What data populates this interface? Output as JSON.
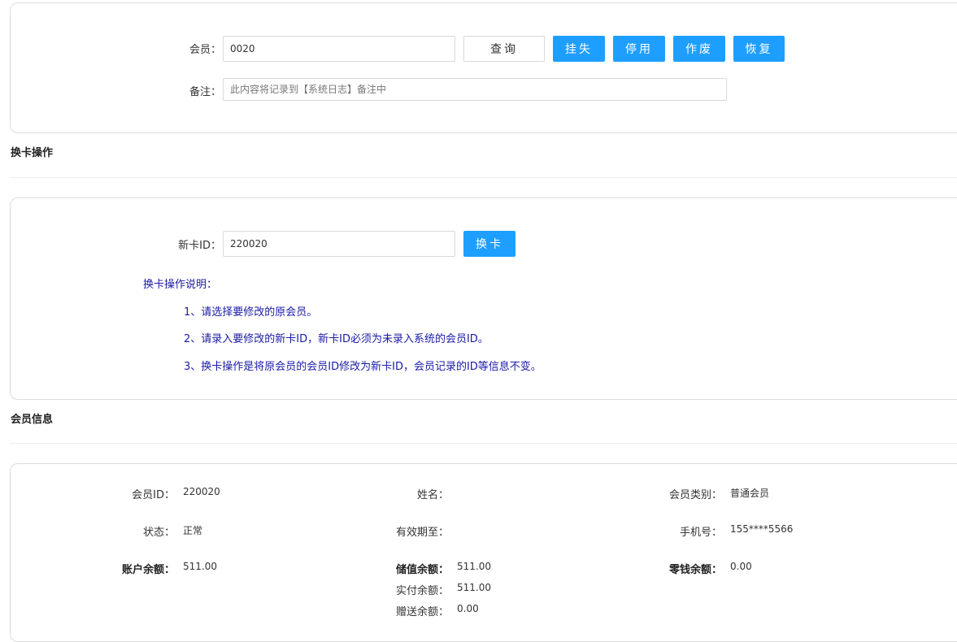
{
  "search": {
    "member_label": "会员：",
    "member_value": "0020",
    "remark_label": "备注：",
    "remark_placeholder": "此内容将记录到【系统日志】备注中",
    "query_btn": "查询",
    "report_loss_btn": "挂失",
    "disable_btn": "停用",
    "void_btn": "作废",
    "restore_btn": "恢复"
  },
  "card_change": {
    "section_title": "换卡操作",
    "new_id_label": "新卡ID：",
    "new_id_value": "220020",
    "change_btn": "换卡",
    "instructions_title": "换卡操作说明：",
    "instructions": [
      "1、请选择要修改的原会员。",
      "2、请录入要修改的新卡ID，新卡ID必须为未录入系统的会员ID。",
      "3、换卡操作是将原会员的会员ID修改为新卡ID，会员记录的ID等信息不变。"
    ]
  },
  "member_info": {
    "section_title": "会员信息",
    "member_id_label": "会员ID：",
    "member_id": "220020",
    "name_label": "姓名：",
    "name": "",
    "type_label": "会员类别：",
    "type": "普通会员",
    "status_label": "状态：",
    "status": "正常",
    "expiry_label": "有效期至：",
    "expiry": "",
    "phone_label": "手机号：",
    "phone": "155****5566",
    "balance_label": "账户余额：",
    "balance": "511.00",
    "stored_label": "储值余额：",
    "stored": "511.00",
    "paid_label": "实付余额：",
    "paid": "511.00",
    "gift_label": "赠送余额：",
    "gift": "0.00",
    "change_label": "零钱余额：",
    "change": "0.00"
  }
}
